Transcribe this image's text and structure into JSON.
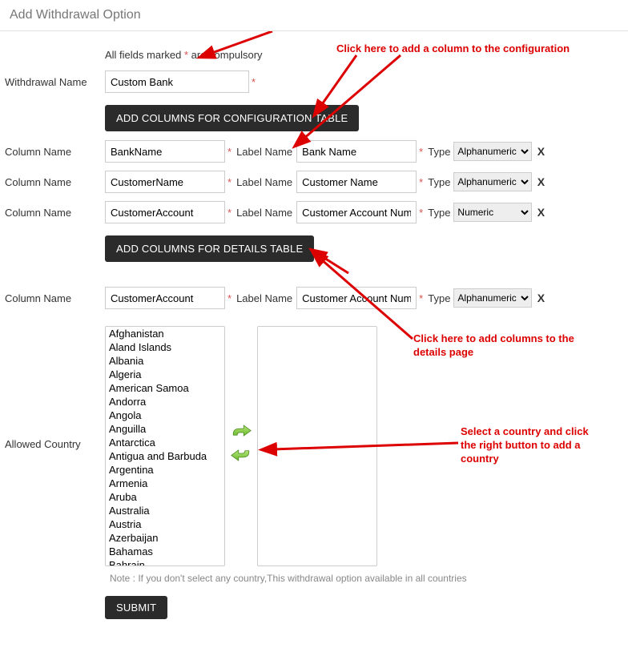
{
  "page_title": "Add Withdrawal Option",
  "help_prefix": "All fields marked ",
  "help_star": "*",
  "help_suffix": " are compulsory",
  "withdrawal_name_label": "Withdrawal Name",
  "withdrawal_name_value": "Custom Bank",
  "btn_add_config": "ADD COLUMNS FOR CONFIGURATION TABLE",
  "btn_add_details": "ADD COLUMNS FOR DETAILS TABLE",
  "column_name_label": "Column Name",
  "label_name_label": "Label Name",
  "type_label": "Type",
  "remove_x": "X",
  "config_rows": [
    {
      "col": "BankName",
      "label": "Bank Name",
      "type": "Alphanumeric"
    },
    {
      "col": "CustomerName",
      "label": "Customer Name",
      "type": "Alphanumeric"
    },
    {
      "col": "CustomerAccount",
      "label": "Customer Account Number",
      "type": "Numeric"
    }
  ],
  "details_rows": [
    {
      "col": "CustomerAccount",
      "label": "Customer Account Number",
      "type": "Alphanumeric"
    }
  ],
  "allowed_country_label": "Allowed Country",
  "countries": [
    "Afghanistan",
    "Aland Islands",
    "Albania",
    "Algeria",
    "American Samoa",
    "Andorra",
    "Angola",
    "Anguilla",
    "Antarctica",
    "Antigua and Barbuda",
    "Argentina",
    "Armenia",
    "Aruba",
    "Australia",
    "Austria",
    "Azerbaijan",
    "Bahamas",
    "Bahrain"
  ],
  "note_text": "Note : If you don't select any country,This withdrawal option available in all countries",
  "submit_label": "SUBMIT",
  "annotations": {
    "a1": "Click here to add a column to the configuration",
    "a2": "Click here to add columns to the details page",
    "a3": "Select a country and click the right button to add a country"
  },
  "type_options": [
    "Alphanumeric",
    "Numeric"
  ]
}
